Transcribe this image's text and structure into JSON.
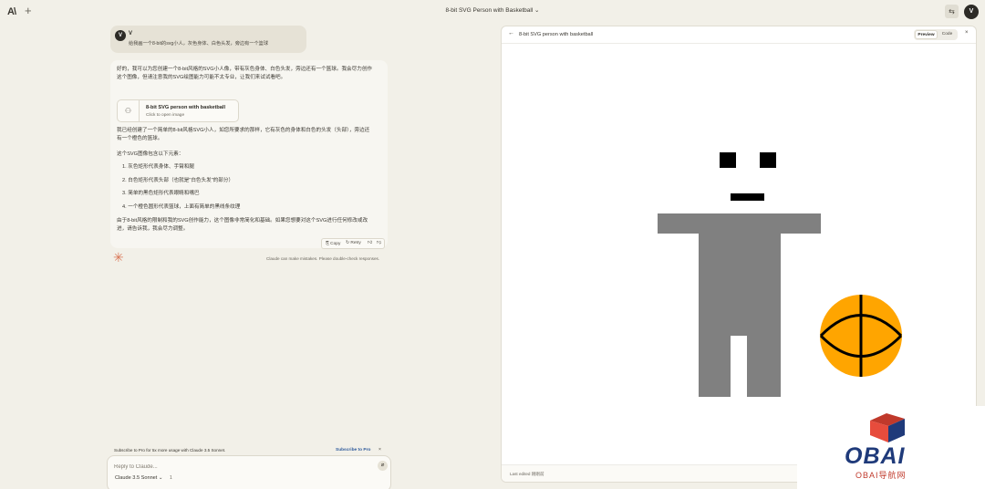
{
  "app": {
    "logo": "A\\",
    "new_chat": "+",
    "title": "8-bit SVG Person with Basketball ⌄",
    "settings_icon": "⇆",
    "user_initial": "V"
  },
  "user_message": {
    "initial": "V",
    "name": "V",
    "text": "给我画一个8-bit的svg小人，灰色身体、白色头发，旁边有一个篮球"
  },
  "assistant_message": {
    "intro": "好的，我可以为您创建一个8-bit风格的SVG小人像，带有灰色身体、白色头发，旁边还有一个篮球。我会尽力创作这个图像，但请注意我的SVG绘图能力可能不太专业，让我们来试试看吧。",
    "artifact_title": "8-bit SVG person with basketball",
    "artifact_subtitle": "Click to open image",
    "after_artifact": "我已经创建了一个简单的8-bit风格SVG小人，如您所要求的那样，它有灰色的身体和白色的头发（头部），旁边还有一个橙色的篮球。",
    "list_intro": "这个SVG图像包含以下元素：",
    "list": [
      "1. 灰色矩形代表身体、手臂和腿",
      "2. 白色矩形代表头部（也就是\"白色头发\"的部分）",
      "3. 简单的黑色矩形代表眼睛和嘴巴",
      "4. 一个橙色圆形代表篮球，上面有简单的黑线条纹理"
    ],
    "closing": "由于8-bit风格的限制和我的SVG创作能力，这个图像非常简化和基础。如果您想要对这个SVG进行任何修改或改进，请告诉我，我会尽力调整。",
    "actions": {
      "copy": "⎘ Copy",
      "retry": "↻ Retry",
      "thumb_up": "👍︎",
      "thumb_down": "👎︎"
    }
  },
  "disclaimer": "Claude can make mistakes. Please double-check responses.",
  "subscribe": {
    "text": "Subscribe to Pro for 5x more usage with Claude 3.5 Sonnet.",
    "link": "Subscribe to Pro",
    "close": "×"
  },
  "composer": {
    "placeholder": "Reply to Claude...",
    "model": "Claude 3.5 Sonnet ⌄",
    "count": "1",
    "attach_icon": "⌀"
  },
  "preview": {
    "back": "←",
    "title": "8-bit SVG person with basketball",
    "tab_preview": "Preview",
    "tab_code": "Code",
    "close": "×",
    "last_edited": "Last edited 刚刚前",
    "colors": {
      "body": "#808080",
      "features": "#000000",
      "ball": "#ffa500"
    }
  },
  "watermark": {
    "brand": "OBAI",
    "sub": "OBAI导航网"
  }
}
